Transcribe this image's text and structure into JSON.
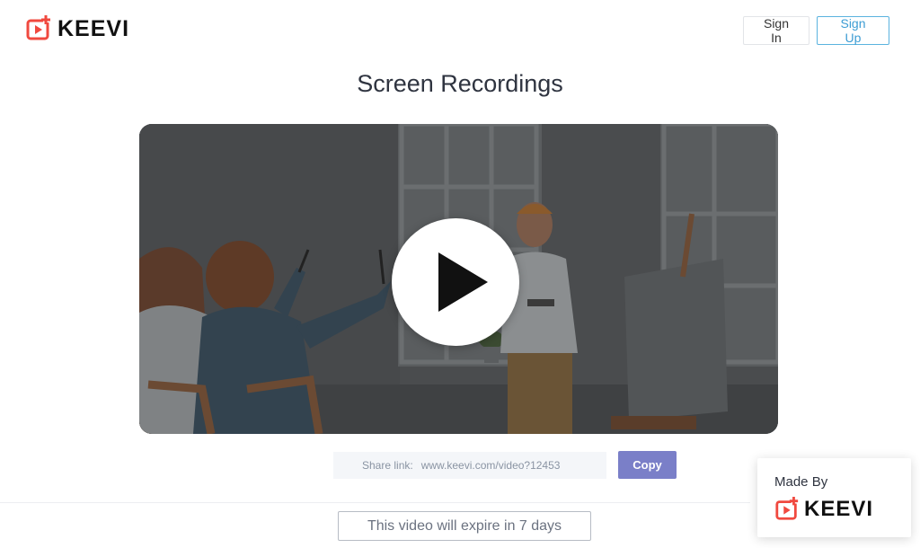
{
  "header": {
    "brand": "KEEVI",
    "sign_in_label": "Sign In",
    "sign_up_label": "Sign Up"
  },
  "page": {
    "title": "Screen Recordings"
  },
  "share": {
    "label": "Share link:",
    "url": "www.keevi.com/video?12453",
    "copy_label": "Copy"
  },
  "expiry": {
    "text": "This video will expire in 7 days"
  },
  "made_by": {
    "label": "Made By",
    "brand": "KEEVI"
  },
  "icons": {
    "logo": "keevi-play-logo-icon",
    "play": "play-icon"
  },
  "colors": {
    "brand_red": "#f0493f",
    "sign_up_blue": "#3d9dd4",
    "copy_button": "#7a7fc8"
  }
}
